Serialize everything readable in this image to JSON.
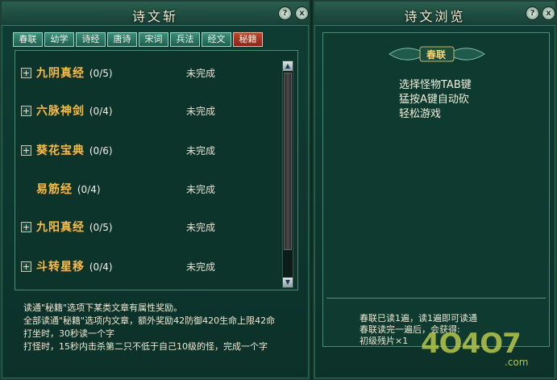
{
  "left_panel": {
    "title": "诗文斩",
    "help_label": "?",
    "close_label": "x",
    "tabs": [
      "春联",
      "幼学",
      "诗经",
      "唐诗",
      "宋词",
      "兵法",
      "经文",
      "秘籍"
    ],
    "active_tab": "秘籍",
    "items": [
      {
        "name": "九阴真经",
        "count": "(0/5)",
        "status": "未完成"
      },
      {
        "name": "六脉神剑",
        "count": "(0/4)",
        "status": "未完成"
      },
      {
        "name": "葵花宝典",
        "count": "(0/6)",
        "status": "未完成"
      },
      {
        "name": "易筋经",
        "count": "(0/4)",
        "status": "未完成"
      },
      {
        "name": "九阳真经",
        "count": "(0/5)",
        "status": "未完成"
      },
      {
        "name": "斗转星移",
        "count": "(0/4)",
        "status": "未完成"
      }
    ],
    "description": [
      "读通\"秘籍\"选项下某类文章有属性奖励。",
      "全部读通\"秘籍\"选项内文章，额外奖励42防御420生命上限42命",
      "打坐时，30秒读一个字",
      "打怪时，15秒内击杀第二只不低于自己10级的怪，完成一个字"
    ]
  },
  "right_panel": {
    "title": "诗文浏览",
    "help_label": "?",
    "close_label": "x",
    "section_title": "春联",
    "tips": [
      "选择怪物TAB键",
      "猛按A键自动砍",
      "轻松游戏"
    ],
    "read_status": [
      "春联已读1遍，读1遍即可读通",
      "春联读完一遍后，会获得:",
      "初级残片×1"
    ],
    "watermark": "4O4O7",
    "watermark_suffix": ".com"
  },
  "colors": {
    "panel_bg": "#0f3d33",
    "item_gold": "#e9bf52",
    "tab_active": "#c0442f",
    "tab_normal": "#3a8f7a"
  }
}
